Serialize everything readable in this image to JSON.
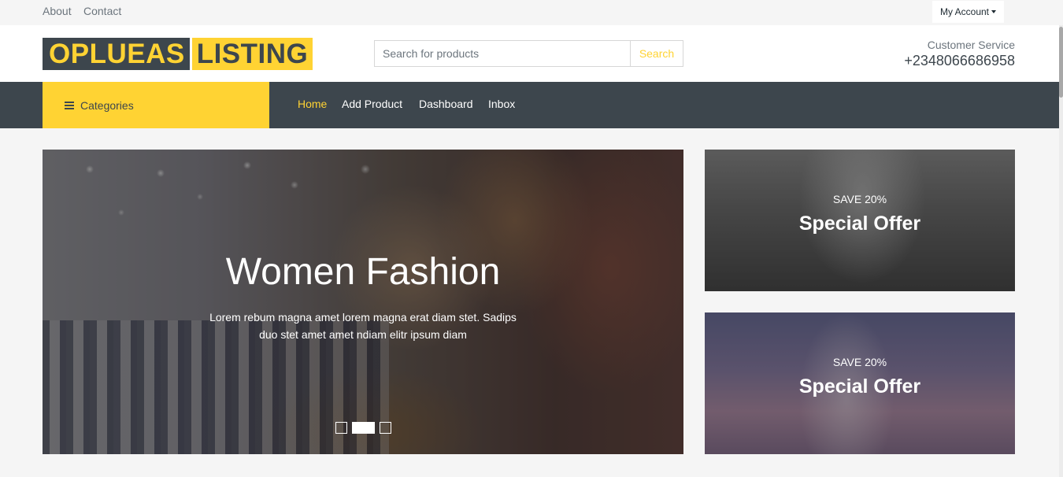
{
  "topbar": {
    "links": [
      "About",
      "Contact"
    ],
    "account_label": "My Account"
  },
  "header": {
    "logo_part1": "OPLUEAS",
    "logo_part2": "LISTING",
    "search_placeholder": "Search for products",
    "search_button": "Search",
    "customer_service_label": "Customer Service",
    "customer_service_phone": "+2348066686958"
  },
  "nav": {
    "categories_label": "Categories",
    "items": [
      "Home",
      "Add Product",
      "Dashboard",
      "Inbox"
    ],
    "active_index": 0
  },
  "hero": {
    "title": "Women Fashion",
    "text": "Lorem rebum magna amet lorem magna erat diam stet. Sadips duo stet amet amet ndiam elitr ipsum diam",
    "slide_count": 3,
    "active_slide": 1
  },
  "offers": [
    {
      "pre": "SAVE 20%",
      "title": "Special Offer"
    },
    {
      "pre": "SAVE 20%",
      "title": "Special Offer"
    }
  ],
  "colors": {
    "accent": "#ffd333",
    "dark": "#3d464d",
    "background": "#f5f5f5"
  }
}
